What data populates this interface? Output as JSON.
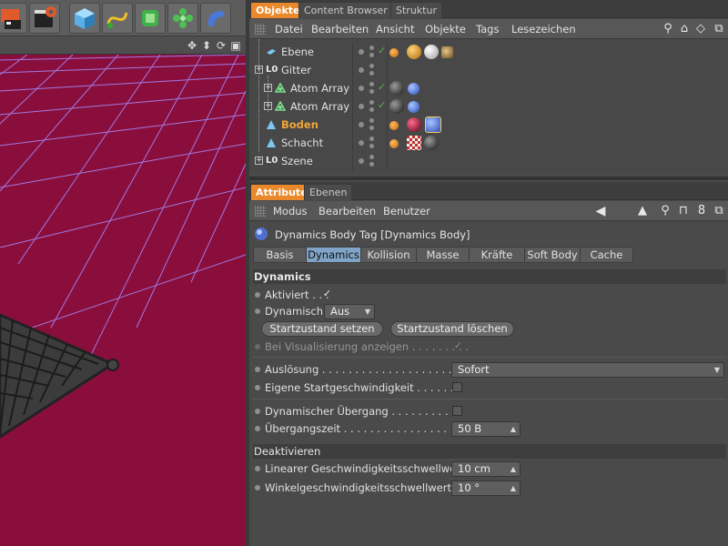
{
  "manager_tabs": [
    "Objekte",
    "Content Browser",
    "Struktur"
  ],
  "object_menu": [
    "Datei",
    "Bearbeiten",
    "Ansicht",
    "Objekte",
    "Tags",
    "Lesezeichen"
  ],
  "objects": [
    {
      "name": "Ebene",
      "highlight": false
    },
    {
      "name": "Gitter",
      "highlight": false
    },
    {
      "name": "Atom Array",
      "highlight": false
    },
    {
      "name": "Atom Array",
      "highlight": false
    },
    {
      "name": "Boden",
      "highlight": true
    },
    {
      "name": "Schacht",
      "highlight": false
    },
    {
      "name": "Szene",
      "highlight": false
    }
  ],
  "attr_tabs": [
    "Attribute",
    "Ebenen"
  ],
  "attr_menu": [
    "Modus",
    "Bearbeiten",
    "Benutzer"
  ],
  "attr_title": "Dynamics Body Tag [Dynamics Body]",
  "property_tabs": [
    "Basis",
    "Dynamics",
    "Kollision",
    "Masse",
    "Kräfte",
    "Soft Body",
    "Cache"
  ],
  "active_property_tab": "Dynamics",
  "dynamics": {
    "section_title": "Dynamics",
    "aktiviert_label": "Aktiviert . . .",
    "aktiviert_check": "✓",
    "dynamisch_label": "Dynamisch",
    "dynamisch_value": "Aus",
    "startzustand_setzen": "Startzustand setzen",
    "startzustand_loeschen": "Startzustand löschen",
    "visualisierung_label": "Bei Visualisierung anzeigen . . . . . . . . .",
    "visualisierung_check": "✓",
    "ausloesung_label": "Auslösung . . . . . . . . . . . . . . . . . . . . .",
    "ausloesung_value": "Sofort",
    "startgeschw_label": "Eigene Startgeschwindigkeit . . . . . . .",
    "uebergang_label": "Dynamischer Übergang . . . . . . . . . . .",
    "uebergangszeit_label": "Übergangszeit . . . . . . . . . . . . . . . . . .",
    "uebergangszeit_value": "50 B"
  },
  "deaktivieren": {
    "section_title": "Deaktivieren",
    "linear_label": "Linearer Geschwindigkeitsschwellwert",
    "linear_value": "10 cm",
    "winkel_label": "Winkelgeschwindigkeitsschwellwert . .",
    "winkel_value": "10 °"
  },
  "colors": {
    "accent_orange": "#e9892b",
    "active_tab_blue": "#7fa4c8",
    "viewport_floor": "#8a0e3c",
    "grid_lines": "#a58cff"
  }
}
